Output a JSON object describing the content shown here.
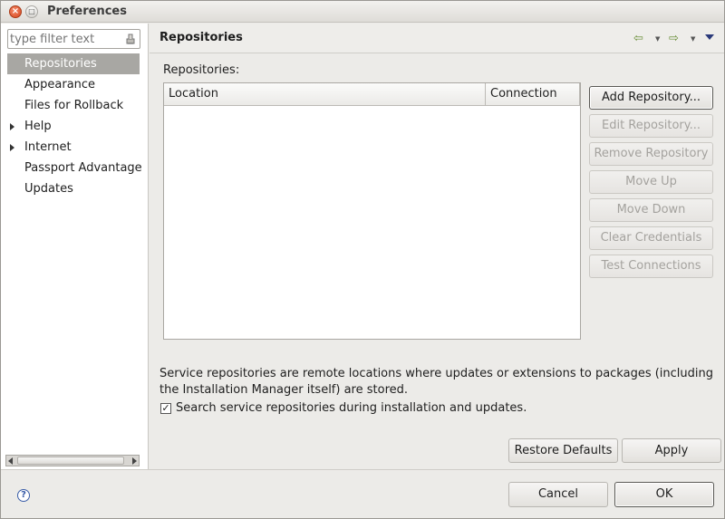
{
  "window": {
    "title": "Preferences"
  },
  "left": {
    "filter_placeholder": "type filter text",
    "items": [
      {
        "label": "Repositories",
        "selected": true,
        "expandable": false
      },
      {
        "label": "Appearance",
        "selected": false,
        "expandable": false
      },
      {
        "label": "Files for Rollback",
        "selected": false,
        "expandable": false
      },
      {
        "label": "Help",
        "selected": false,
        "expandable": true
      },
      {
        "label": "Internet",
        "selected": false,
        "expandable": true
      },
      {
        "label": "Passport Advantage",
        "selected": false,
        "expandable": false
      },
      {
        "label": "Updates",
        "selected": false,
        "expandable": false
      }
    ]
  },
  "page": {
    "title": "Repositories",
    "repositories_label": "Repositories:",
    "table": {
      "columns": [
        "Location",
        "Connection"
      ],
      "rows": []
    },
    "buttons": {
      "add": "Add Repository...",
      "edit": "Edit Repository...",
      "remove": "Remove Repository",
      "move_up": "Move Up",
      "move_down": "Move Down",
      "clear_credentials": "Clear Credentials",
      "test_connections": "Test Connections"
    },
    "description": "Service repositories are remote locations where updates or extensions to packages (including the Installation Manager itself) are stored.",
    "checkbox_label": "Search service repositories during installation and updates.",
    "checkbox_checked": true,
    "restore_defaults": "Restore Defaults",
    "apply": "Apply"
  },
  "footer": {
    "cancel": "Cancel",
    "ok": "OK"
  }
}
